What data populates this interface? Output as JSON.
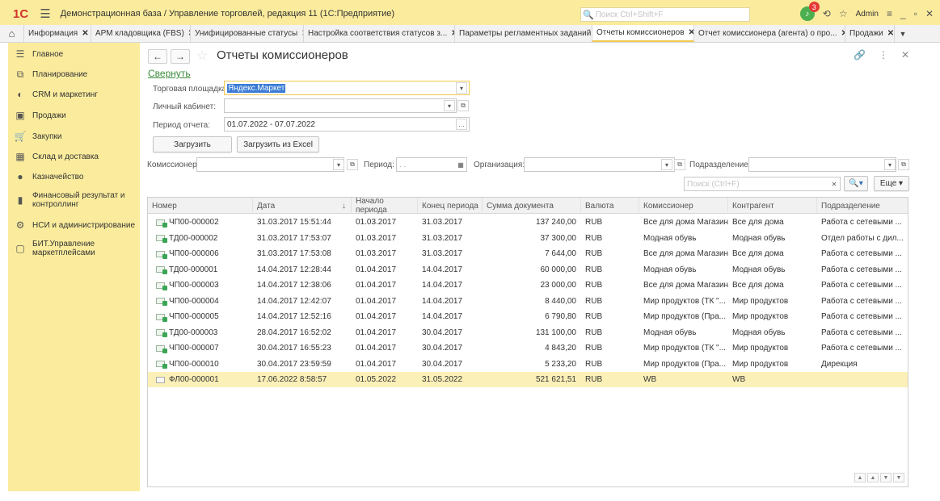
{
  "app": {
    "logo": "1С",
    "title": "Демонстрационная база / Управление торговлей, редакция 11  (1С:Предприятие)",
    "search_placeholder": "Поиск Ctrl+Shift+F",
    "notifications_count": "3",
    "user": "Admin"
  },
  "tabs": [
    {
      "label": "Информация"
    },
    {
      "label": "АРМ кладовщика (FBS)"
    },
    {
      "label": "Унифицированные статусы"
    },
    {
      "label": "Настройка соответствия статусов з..."
    },
    {
      "label": "Параметры регламентных заданий"
    },
    {
      "label": "Отчеты комиссионеров"
    },
    {
      "label": "Отчет комиссионера (агента) о про..."
    },
    {
      "label": "Продажи"
    }
  ],
  "sidebar": {
    "items": [
      {
        "label": "Главное",
        "icon": "list-icon"
      },
      {
        "label": "Планирование",
        "icon": "planning-icon"
      },
      {
        "label": "CRM и маркетинг",
        "icon": "crm-icon"
      },
      {
        "label": "Продажи",
        "icon": "bag-icon"
      },
      {
        "label": "Закупки",
        "icon": "cart-icon"
      },
      {
        "label": "Склад и доставка",
        "icon": "warehouse-icon"
      },
      {
        "label": "Казначейство",
        "icon": "treasury-icon"
      },
      {
        "label": "Финансовый результат и контроллинг",
        "icon": "chart-icon"
      },
      {
        "label": "НСИ и администрирование",
        "icon": "gear-icon"
      },
      {
        "label": "БИТ.Управление маркетплейсами",
        "icon": "chat-icon"
      }
    ]
  },
  "page": {
    "title": "Отчеты комиссионеров",
    "collapse_link": "Свернуть",
    "marketplace_label": "Торговая площадка:",
    "marketplace_value": "Яндекс.Маркет",
    "cabinet_label": "Личный кабинет:",
    "cabinet_value": "",
    "period_label": "Период отчета:",
    "period_value": "01.07.2022 - 07.07.2022",
    "load_button": "Загрузить",
    "load_excel_button": "Загрузить из Excel",
    "commissioner_label": "Комиссионер:",
    "period_filter_label": "Период:",
    "period_filter_value": ". .",
    "org_label": "Организация:",
    "division_label": "Подразделение:",
    "search_placeholder": "Поиск (Ctrl+F)",
    "more_button": "Еще"
  },
  "table": {
    "columns": [
      "Номер",
      "Дата",
      "Начало периода",
      "Конец периода",
      "Сумма документа",
      "Валюта",
      "Комиссионер",
      "Контрагент",
      "Подразделение"
    ],
    "sort_indicator": "↓",
    "rows": [
      {
        "num": "ЧП00-000002",
        "date": "31.03.2017 15:51:44",
        "start": "01.03.2017",
        "end": "31.03.2017",
        "sum": "137 240,00",
        "cur": "RUB",
        "comm": "Все для дома Магазин",
        "contr": "Все для дома",
        "div": "Работа с сетевыми ...",
        "posted": true
      },
      {
        "num": "ТД00-000002",
        "date": "31.03.2017 17:53:07",
        "start": "01.03.2017",
        "end": "31.03.2017",
        "sum": "37 300,00",
        "cur": "RUB",
        "comm": "Модная обувь",
        "contr": "Модная обувь",
        "div": "Отдел работы с дил...",
        "posted": true
      },
      {
        "num": "ЧП00-000006",
        "date": "31.03.2017 17:53:08",
        "start": "01.03.2017",
        "end": "31.03.2017",
        "sum": "7 644,00",
        "cur": "RUB",
        "comm": "Все для дома Магазин",
        "contr": "Все для дома",
        "div": "Работа с сетевыми ...",
        "posted": true
      },
      {
        "num": "ТД00-000001",
        "date": "14.04.2017 12:28:44",
        "start": "01.04.2017",
        "end": "14.04.2017",
        "sum": "60 000,00",
        "cur": "RUB",
        "comm": "Модная обувь",
        "contr": "Модная обувь",
        "div": "Работа с сетевыми ...",
        "posted": true
      },
      {
        "num": "ЧП00-000003",
        "date": "14.04.2017 12:38:06",
        "start": "01.04.2017",
        "end": "14.04.2017",
        "sum": "23 000,00",
        "cur": "RUB",
        "comm": "Все для дома Магазин",
        "contr": "Все для дома",
        "div": "Работа с сетевыми ...",
        "posted": true
      },
      {
        "num": "ЧП00-000004",
        "date": "14.04.2017 12:42:07",
        "start": "01.04.2017",
        "end": "14.04.2017",
        "sum": "8 440,00",
        "cur": "RUB",
        "comm": "Мир продуктов (ТК \"...",
        "contr": "Мир продуктов",
        "div": "Работа с сетевыми ...",
        "posted": true
      },
      {
        "num": "ЧП00-000005",
        "date": "14.04.2017 12:52:16",
        "start": "01.04.2017",
        "end": "14.04.2017",
        "sum": "6 790,80",
        "cur": "RUB",
        "comm": "Мир продуктов (Пра...",
        "contr": "Мир продуктов",
        "div": "Работа с сетевыми ...",
        "posted": true
      },
      {
        "num": "ТД00-000003",
        "date": "28.04.2017 16:52:02",
        "start": "01.04.2017",
        "end": "30.04.2017",
        "sum": "131 100,00",
        "cur": "RUB",
        "comm": "Модная обувь",
        "contr": "Модная обувь",
        "div": "Работа с сетевыми ...",
        "posted": true
      },
      {
        "num": "ЧП00-000007",
        "date": "30.04.2017 16:55:23",
        "start": "01.04.2017",
        "end": "30.04.2017",
        "sum": "4 843,20",
        "cur": "RUB",
        "comm": "Мир продуктов (ТК \"...",
        "contr": "Мир продуктов",
        "div": "Работа с сетевыми ...",
        "posted": true
      },
      {
        "num": "ЧП00-000010",
        "date": "30.04.2017 23:59:59",
        "start": "01.04.2017",
        "end": "30.04.2017",
        "sum": "5 233,20",
        "cur": "RUB",
        "comm": "Мир продуктов (Пра...",
        "contr": "Мир продуктов",
        "div": "Дирекция",
        "posted": true
      },
      {
        "num": "ФЛ00-000001",
        "date": "17.06.2022 8:58:57",
        "start": "01.05.2022",
        "end": "31.05.2022",
        "sum": "521 621,51",
        "cur": "RUB",
        "comm": "WB",
        "contr": "WB",
        "div": "",
        "posted": false,
        "selected": true
      }
    ]
  }
}
